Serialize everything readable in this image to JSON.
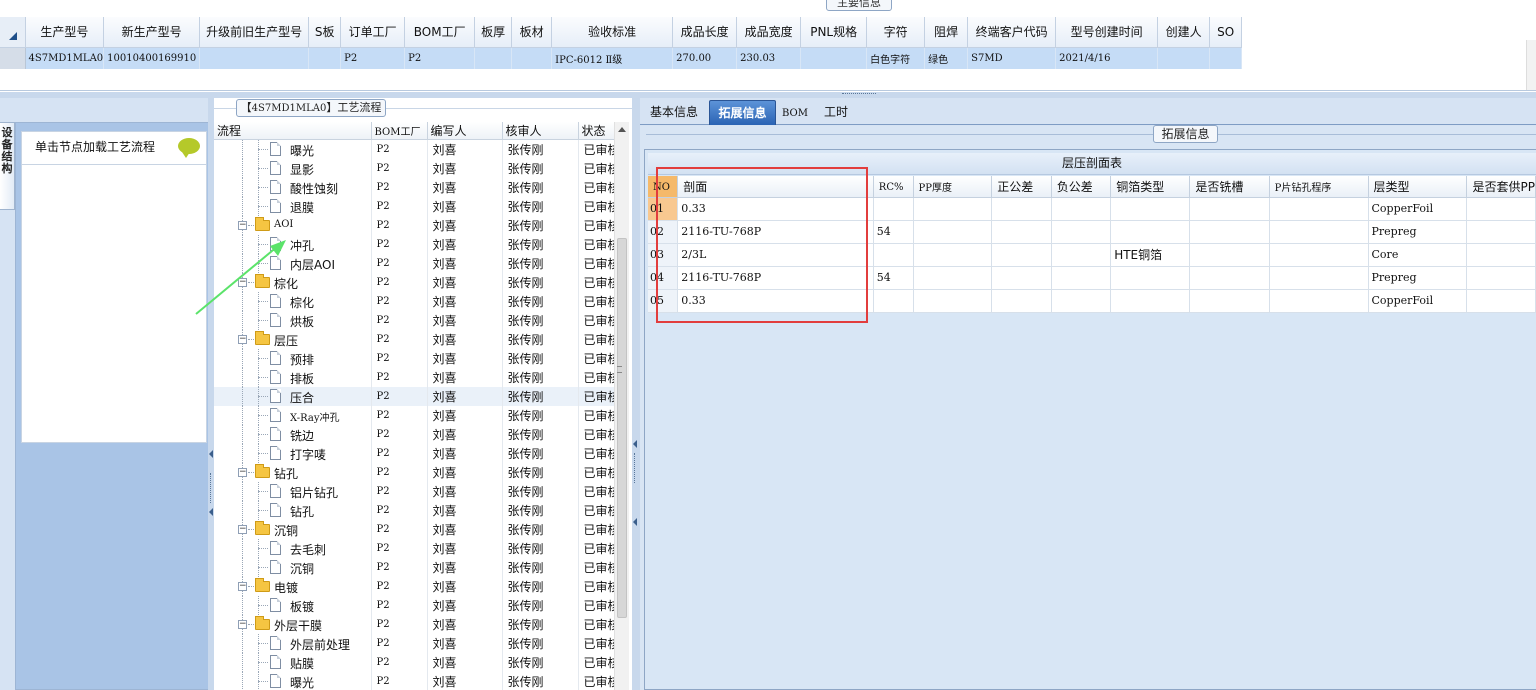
{
  "top": {
    "tab_label": "主要信息",
    "columns": [
      "生产型号",
      "新生产型号",
      "升级前旧生产型号",
      "S板",
      "订单工厂",
      "BOM工厂",
      "板厚",
      "板材",
      "验收标准",
      "成品长度",
      "成品宽度",
      "PNL规格",
      "字符",
      "阻焊",
      "终端客户代码",
      "型号创建时间",
      "创建人",
      "SO"
    ],
    "row": [
      "4S7MD1MLA0",
      "10010400169910",
      "",
      "",
      "P2",
      "P2",
      "",
      "",
      "IPC-6012 Ⅱ级",
      "270.00",
      "230.03",
      "",
      "白色字符",
      "绿色",
      "S7MD",
      "2021/4/16",
      "",
      ""
    ]
  },
  "left": {
    "vertical_tab": "设备结构",
    "node_hint": "单击节点加载工艺流程"
  },
  "process": {
    "title_prefix": "【",
    "title_model": "4S7MD1MLA0",
    "title_suffix": "】工艺流程",
    "headers": {
      "flow": "流程",
      "bom": "BOM工厂",
      "writer": "编写人",
      "reviewer": "核审人",
      "status": "状态"
    },
    "rows": [
      {
        "level": 2,
        "label": "曝光",
        "bom": "P2",
        "writer": "刘喜",
        "reviewer": "张传刚",
        "status": "已审核"
      },
      {
        "level": 2,
        "label": "显影",
        "bom": "P2",
        "writer": "刘喜",
        "reviewer": "张传刚",
        "status": "已审核"
      },
      {
        "level": 2,
        "label": "酸性蚀刻",
        "bom": "P2",
        "writer": "刘喜",
        "reviewer": "张传刚",
        "status": "已审核"
      },
      {
        "level": 2,
        "label": "退膜",
        "bom": "P2",
        "writer": "刘喜",
        "reviewer": "张传刚",
        "status": "已审核"
      },
      {
        "level": 1,
        "label": "AOI",
        "bom": "P2",
        "writer": "刘喜",
        "reviewer": "张传刚",
        "status": "已审核"
      },
      {
        "level": 2,
        "label": "冲孔",
        "bom": "P2",
        "writer": "刘喜",
        "reviewer": "张传刚",
        "status": "已审核"
      },
      {
        "level": 2,
        "label": "内层AOI",
        "bom": "P2",
        "writer": "刘喜",
        "reviewer": "张传刚",
        "status": "已审核"
      },
      {
        "level": 1,
        "label": "棕化",
        "bom": "P2",
        "writer": "刘喜",
        "reviewer": "张传刚",
        "status": "已审核"
      },
      {
        "level": 2,
        "label": "棕化",
        "bom": "P2",
        "writer": "刘喜",
        "reviewer": "张传刚",
        "status": "已审核"
      },
      {
        "level": 2,
        "label": "烘板",
        "bom": "P2",
        "writer": "刘喜",
        "reviewer": "张传刚",
        "status": "已审核"
      },
      {
        "level": 1,
        "label": "层压",
        "bom": "P2",
        "writer": "刘喜",
        "reviewer": "张传刚",
        "status": "已审核"
      },
      {
        "level": 2,
        "label": "预排",
        "bom": "P2",
        "writer": "刘喜",
        "reviewer": "张传刚",
        "status": "已审核"
      },
      {
        "level": 2,
        "label": "排板",
        "bom": "P2",
        "writer": "刘喜",
        "reviewer": "张传刚",
        "status": "已审核"
      },
      {
        "level": 2,
        "label": "压合",
        "bom": "P2",
        "writer": "刘喜",
        "reviewer": "张传刚",
        "status": "已审核",
        "selected": true
      },
      {
        "level": 2,
        "label": "X-Ray冲孔",
        "bom": "P2",
        "writer": "刘喜",
        "reviewer": "张传刚",
        "status": "已审核"
      },
      {
        "level": 2,
        "label": "铣边",
        "bom": "P2",
        "writer": "刘喜",
        "reviewer": "张传刚",
        "status": "已审核"
      },
      {
        "level": 2,
        "label": "打字唛",
        "bom": "P2",
        "writer": "刘喜",
        "reviewer": "张传刚",
        "status": "已审核"
      },
      {
        "level": 1,
        "label": "钻孔",
        "bom": "P2",
        "writer": "刘喜",
        "reviewer": "张传刚",
        "status": "已审核"
      },
      {
        "level": 2,
        "label": "铝片钻孔",
        "bom": "P2",
        "writer": "刘喜",
        "reviewer": "张传刚",
        "status": "已审核"
      },
      {
        "level": 2,
        "label": "钻孔",
        "bom": "P2",
        "writer": "刘喜",
        "reviewer": "张传刚",
        "status": "已审核"
      },
      {
        "level": 1,
        "label": "沉铜",
        "bom": "P2",
        "writer": "刘喜",
        "reviewer": "张传刚",
        "status": "已审核"
      },
      {
        "level": 2,
        "label": "去毛刺",
        "bom": "P2",
        "writer": "刘喜",
        "reviewer": "张传刚",
        "status": "已审核"
      },
      {
        "level": 2,
        "label": "沉铜",
        "bom": "P2",
        "writer": "刘喜",
        "reviewer": "张传刚",
        "status": "已审核"
      },
      {
        "level": 1,
        "label": "电镀",
        "bom": "P2",
        "writer": "刘喜",
        "reviewer": "张传刚",
        "status": "已审核"
      },
      {
        "level": 2,
        "label": "板镀",
        "bom": "P2",
        "writer": "刘喜",
        "reviewer": "张传刚",
        "status": "已审核"
      },
      {
        "level": 1,
        "label": "外层干膜",
        "bom": "P2",
        "writer": "刘喜",
        "reviewer": "张传刚",
        "status": "已审核"
      },
      {
        "level": 2,
        "label": "外层前处理",
        "bom": "P2",
        "writer": "刘喜",
        "reviewer": "张传刚",
        "status": "已审核"
      },
      {
        "level": 2,
        "label": "贴膜",
        "bom": "P2",
        "writer": "刘喜",
        "reviewer": "张传刚",
        "status": "已审核"
      },
      {
        "level": 2,
        "label": "曝光",
        "bom": "P2",
        "writer": "刘喜",
        "reviewer": "张传刚",
        "status": "已审核"
      }
    ]
  },
  "tabs": [
    "基本信息",
    "拓展信息",
    "BOM",
    "工时"
  ],
  "active_tab": "拓展信息",
  "ext": {
    "title": "拓展信息",
    "section_title": "层压剖面表",
    "headers": [
      "NO",
      "剖面",
      "RC%",
      "PP厚度",
      "正公差",
      "负公差",
      "铜箔类型",
      "是否铣槽",
      "P片钻孔程序",
      "层类型",
      "是否套供PP"
    ],
    "rows": [
      [
        "01",
        "0.33",
        "",
        "",
        "",
        "",
        "",
        "",
        "",
        "CopperFoil",
        ""
      ],
      [
        "02",
        "2116-TU-768P",
        "54",
        "",
        "",
        "",
        "",
        "",
        "",
        "Prepreg",
        ""
      ],
      [
        "03",
        "2/3L",
        "",
        "",
        "",
        "",
        "HTE铜箔",
        "",
        "",
        "Core",
        ""
      ],
      [
        "04",
        "2116-TU-768P",
        "54",
        "",
        "",
        "",
        "",
        "",
        "",
        "Prepreg",
        ""
      ],
      [
        "05",
        "0.33",
        "",
        "",
        "",
        "",
        "",
        "",
        "",
        "CopperFoil",
        ""
      ]
    ]
  },
  "colors": {
    "accent": "#2a63b4",
    "selection": "#c5dcf6",
    "annotation_box": "#e23d3d",
    "annotation_arrow": "#5be36a"
  }
}
